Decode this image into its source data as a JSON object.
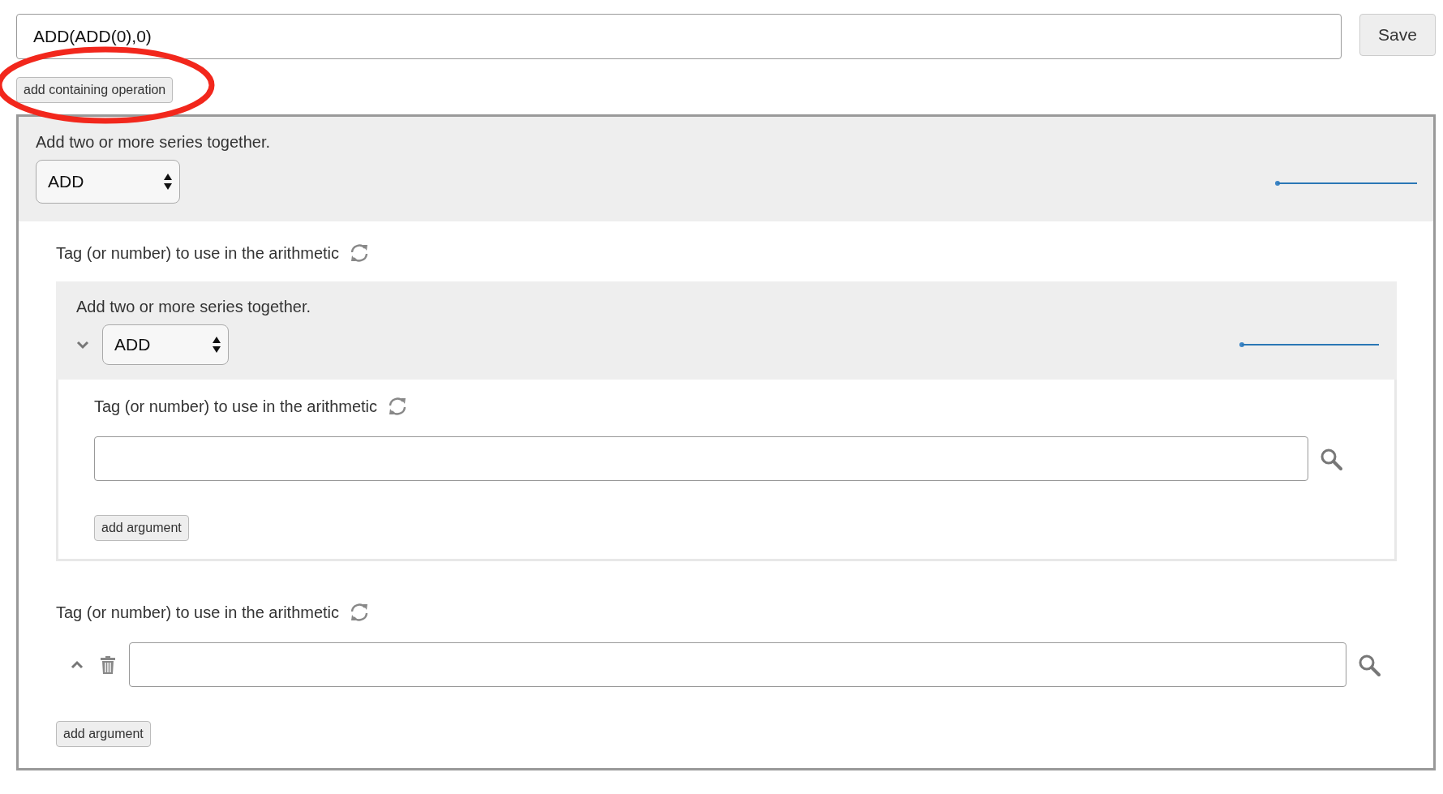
{
  "expression_field": {
    "value": "ADD(ADD(0),0)"
  },
  "save_button": "Save",
  "add_containing_operation_button": "add containing operation",
  "operation": {
    "description": "Add two or more series together.",
    "select": "ADD",
    "arguments": [
      {
        "kind": "operation",
        "label": "Tag (or number) to use in the arithmetic",
        "operation": {
          "description": "Add two or more series together.",
          "select": "ADD",
          "expanded": true,
          "arguments": [
            {
              "kind": "tag",
              "label": "Tag (or number) to use in the arithmetic",
              "deletable": false
            }
          ],
          "add_argument_button": "add argument"
        }
      },
      {
        "kind": "tag",
        "label": "Tag (or number) to use in the arithmetic",
        "expanded": false,
        "deletable": true
      }
    ],
    "add_argument_button": "add argument"
  }
}
